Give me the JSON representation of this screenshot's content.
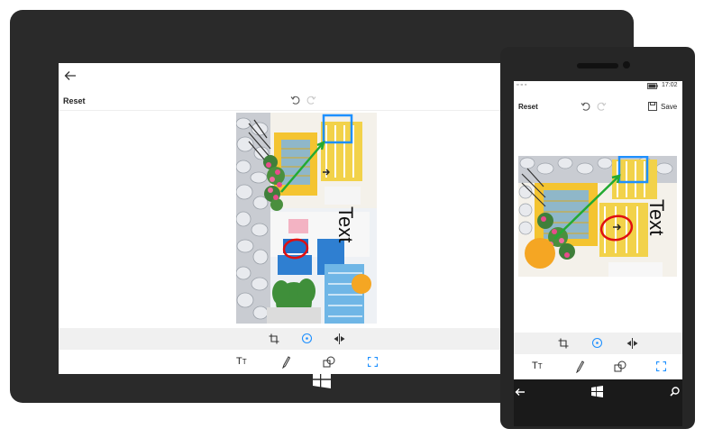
{
  "tablet": {
    "toolbar": {
      "reset_label": "Reset"
    },
    "photo": {
      "overlay_text": "Text"
    }
  },
  "phone": {
    "status": {
      "time": "17:02"
    },
    "toolbar": {
      "reset_label": "Reset",
      "save_label": "Save"
    },
    "photo": {
      "overlay_text": "Text"
    }
  },
  "icons": {
    "back": "back-arrow-icon",
    "undo": "undo-icon",
    "redo": "redo-icon",
    "save": "save-icon",
    "crop": "crop-icon",
    "rotate": "rotate-icon",
    "flip": "flip-icon",
    "text": "text-tool-icon",
    "pen": "pen-icon",
    "shape": "shape-icon",
    "select": "select-icon",
    "windows": "windows-logo-icon",
    "search": "search-icon"
  },
  "colors": {
    "device": "#2a2a2a",
    "accent_blue": "#1e90ff",
    "annotation_green": "#22aa33",
    "annotation_red": "#e01010",
    "annotation_orange": "#f5a623",
    "tabs_bar": "#f0f0f0"
  }
}
